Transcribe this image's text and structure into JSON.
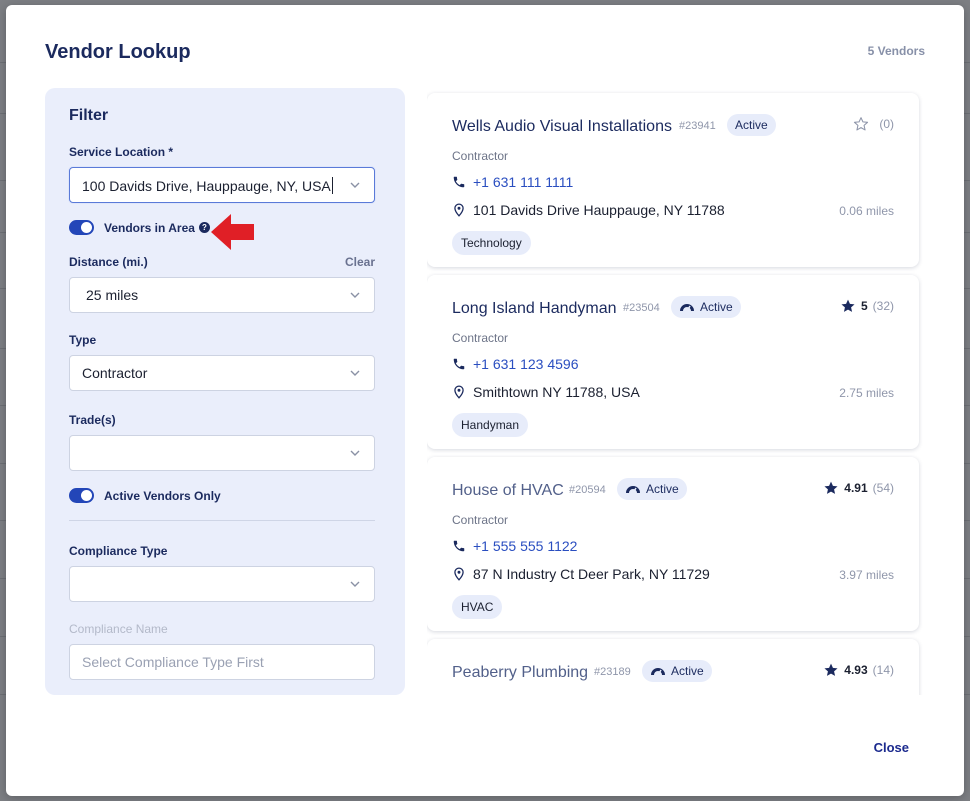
{
  "modal": {
    "title": "Vendor Lookup",
    "vendor_count": "5 Vendors",
    "close_label": "Close"
  },
  "filter": {
    "title": "Filter",
    "service_location": {
      "label": "Service Location *",
      "value": "100 Davids Drive, Hauppauge, NY, USA"
    },
    "vendors_in_area": {
      "label": "Vendors in Area",
      "on": true
    },
    "distance": {
      "label": "Distance (mi.)",
      "clear_label": "Clear",
      "value": "25 miles"
    },
    "type": {
      "label": "Type",
      "value": "Contractor"
    },
    "trades": {
      "label": "Trade(s)",
      "value": ""
    },
    "active_only": {
      "label": "Active Vendors Only",
      "on": true
    },
    "compliance_type": {
      "label": "Compliance Type",
      "value": ""
    },
    "compliance_name": {
      "label": "Compliance Name",
      "placeholder": "Select Compliance Type First"
    }
  },
  "vendors": [
    {
      "name": "Wells Audio Visual Installations",
      "id": "#23941",
      "status": "Active",
      "rating_score": "",
      "rating_count": "(0)",
      "starred": false,
      "type": "Contractor",
      "phone": "+1 631 111 1111",
      "address": "101 Davids Drive Hauppauge, NY 11788",
      "distance": "0.06 miles",
      "tag": "Technology"
    },
    {
      "name": "Long Island Handyman",
      "id": "#23504",
      "status": "Active",
      "rating_score": "5",
      "rating_count": "(32)",
      "starred": true,
      "type": "Contractor",
      "phone": "+1 631 123 4596",
      "address": "Smithtown NY 11788, USA",
      "distance": "2.75 miles",
      "tag": "Handyman"
    },
    {
      "name": "House of HVAC",
      "id": "#20594",
      "status": "Active",
      "rating_score": "4.91",
      "rating_count": "(54)",
      "starred": true,
      "type": "Contractor",
      "phone": "+1 555 555 1122",
      "address": "87 N Industry Ct Deer Park, NY 11729",
      "distance": "3.97 miles",
      "tag": "HVAC"
    },
    {
      "name": "Peaberry Plumbing",
      "id": "#23189",
      "status": "Active",
      "rating_score": "4.93",
      "rating_count": "(14)",
      "starred": true
    }
  ],
  "colors": {
    "accent": "#2346b8",
    "title": "#1b2a5e",
    "panel": "#eaeefb",
    "arrow": "#e01f26"
  },
  "icons": [
    "chevron-down-icon",
    "help-icon",
    "phone-icon",
    "location-pin-icon",
    "star-icon",
    "star-outline-icon",
    "active-gauge-icon",
    "red-arrow-annotation"
  ]
}
